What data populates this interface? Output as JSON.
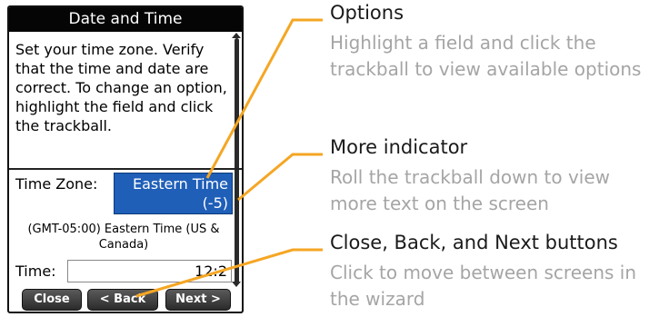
{
  "device": {
    "title": "Date and Time",
    "intro": "Set your time zone. Verify that the time and date are correct. To change an option, highlight the field and click the trackball.",
    "time_zone_label": "Time Zone:",
    "time_zone_value": "Eastern Time",
    "time_zone_offset": "(-5)",
    "time_zone_description": "(GMT-05:00) Eastern Time (US & Canada)",
    "time_label": "Time:",
    "time_value": "12:2",
    "buttons": {
      "close": "Close",
      "back": "< Back",
      "next": "Next >"
    }
  },
  "callouts": [
    {
      "title": "Options",
      "description": "Highlight a field and click the trackball to view available options"
    },
    {
      "title": "More indicator",
      "description": "Roll the trackball down to view more text on the screen"
    },
    {
      "title": "Close, Back, and Next buttons",
      "description": "Click to move between screens in the wizard"
    }
  ],
  "colors": {
    "leader": "#f5a623",
    "highlight": "#1f5fb8",
    "callout_title": "#1a1a1a",
    "callout_description": "#a5a5a5"
  }
}
